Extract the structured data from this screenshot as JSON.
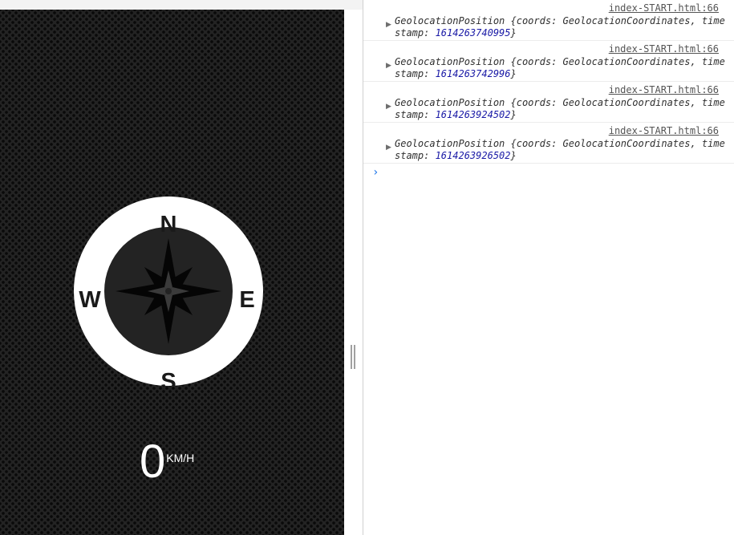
{
  "compass": {
    "north": "N",
    "east": "E",
    "south": "S",
    "west": "W"
  },
  "speed": {
    "value": "0",
    "unit": "KM/H"
  },
  "console": {
    "prompt_symbol": "›",
    "messages": [
      {
        "source": "index-START.html:66",
        "object": "GeolocationPosition",
        "open": " {coords: ",
        "coords_type": "GeolocationCoordinates",
        "ts_key": ", timestamp: ",
        "timestamp": "1614263740995",
        "close": "}"
      },
      {
        "source": "index-START.html:66",
        "object": "GeolocationPosition",
        "open": " {coords: ",
        "coords_type": "GeolocationCoordinates",
        "ts_key": ", timestamp: ",
        "timestamp": "1614263742996",
        "close": "}"
      },
      {
        "source": "index-START.html:66",
        "object": "GeolocationPosition",
        "open": " {coords: ",
        "coords_type": "GeolocationCoordinates",
        "ts_key": ", timestamp: ",
        "timestamp": "1614263924502",
        "close": "}"
      },
      {
        "source": "index-START.html:66",
        "object": "GeolocationPosition",
        "open": " {coords: ",
        "coords_type": "GeolocationCoordinates",
        "ts_key": ", timestamp: ",
        "timestamp": "1614263926502",
        "close": "}"
      }
    ]
  },
  "icons": {
    "expand": "triangle-right-icon",
    "prompt": "chevron-right-icon",
    "compass": "compass-rose-icon"
  }
}
